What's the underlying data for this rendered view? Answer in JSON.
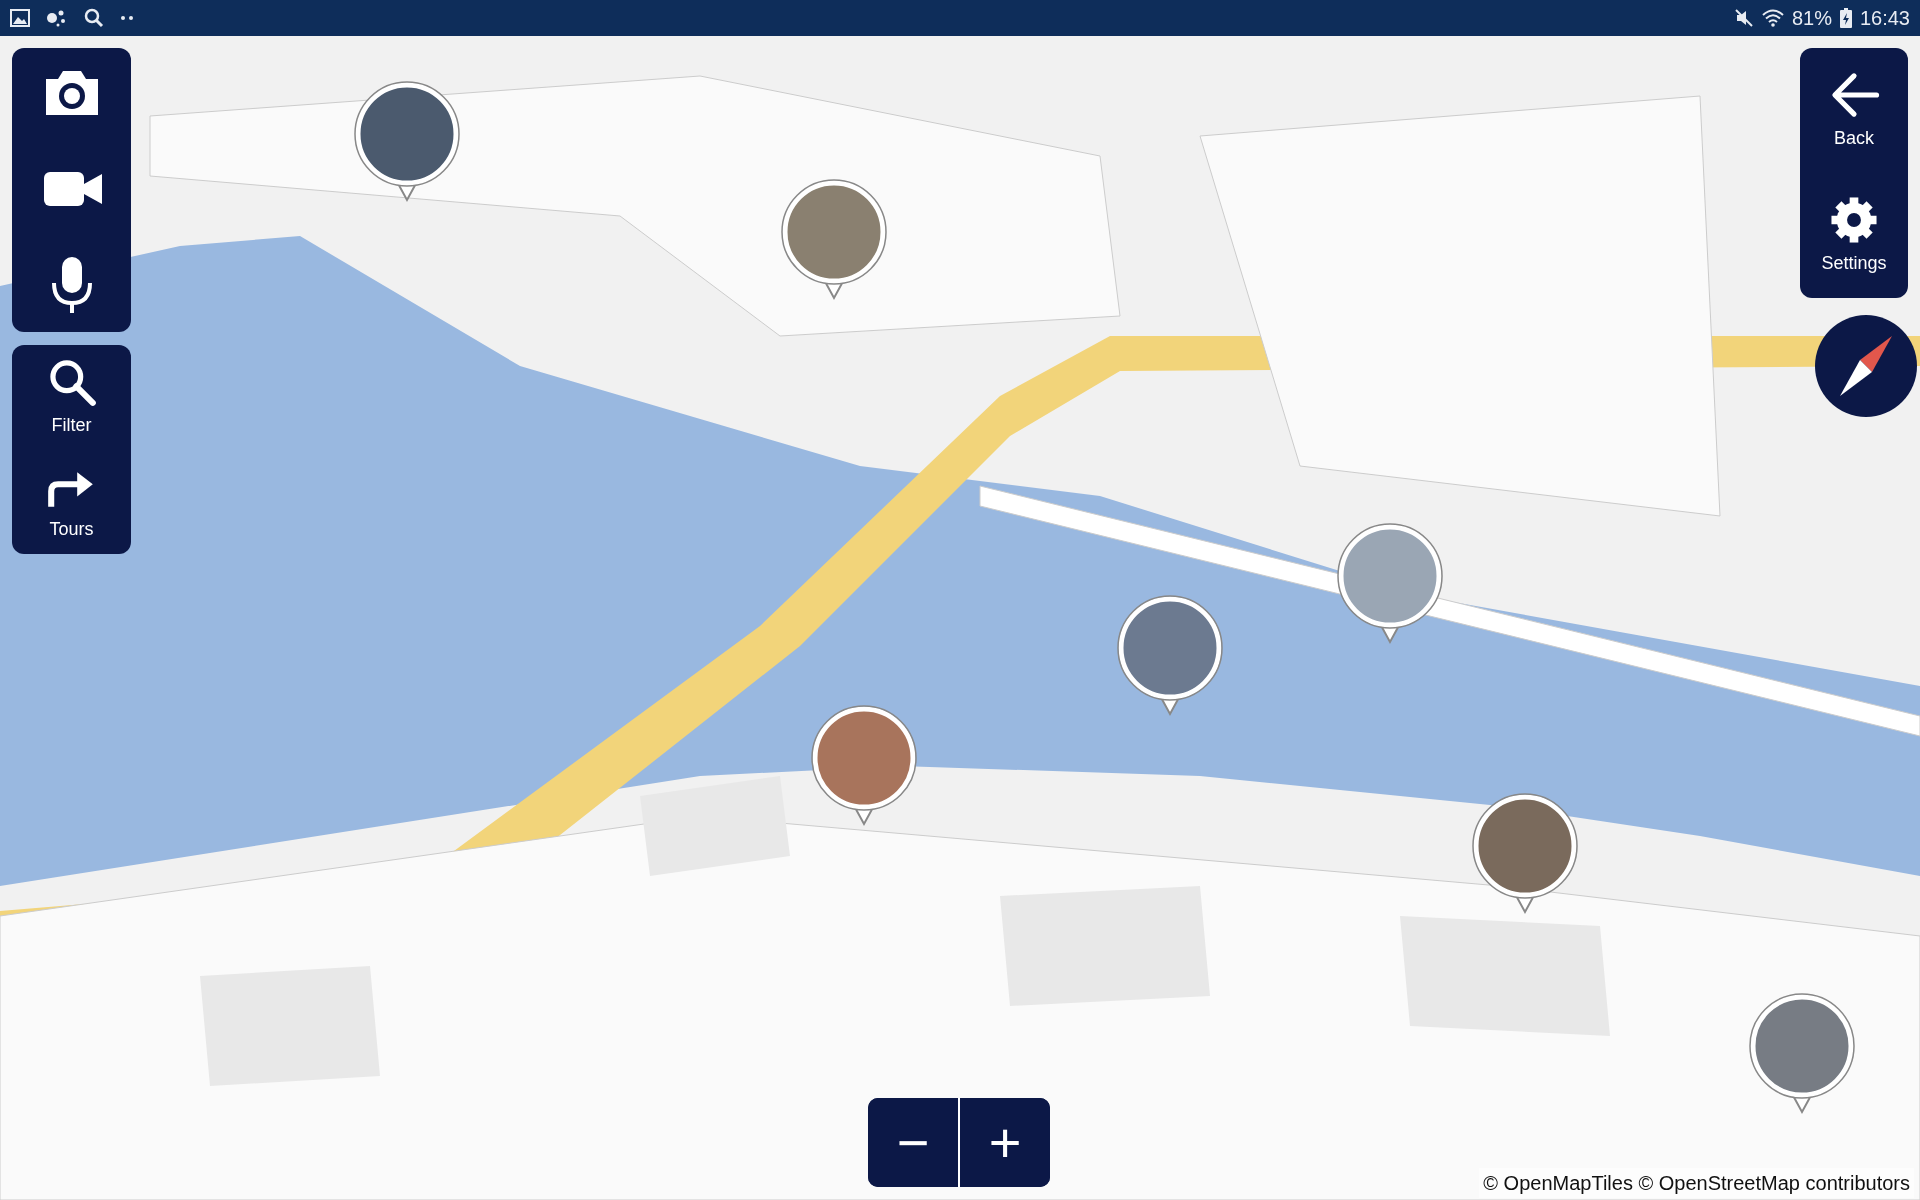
{
  "status_bar": {
    "battery": "81%",
    "time": "16:43"
  },
  "media_tools": [
    {
      "kind": "camera"
    },
    {
      "kind": "video"
    },
    {
      "kind": "mic"
    }
  ],
  "nav_tools": [
    {
      "kind": "search",
      "label": "Filter"
    },
    {
      "kind": "route",
      "label": "Tours"
    }
  ],
  "right_tools": [
    {
      "kind": "back",
      "label": "Back"
    },
    {
      "kind": "settings",
      "label": "Settings"
    }
  ],
  "zoom": {
    "minus": "−",
    "plus": "+"
  },
  "attribution": "© OpenMapTiles © OpenStreetMap contributors"
}
